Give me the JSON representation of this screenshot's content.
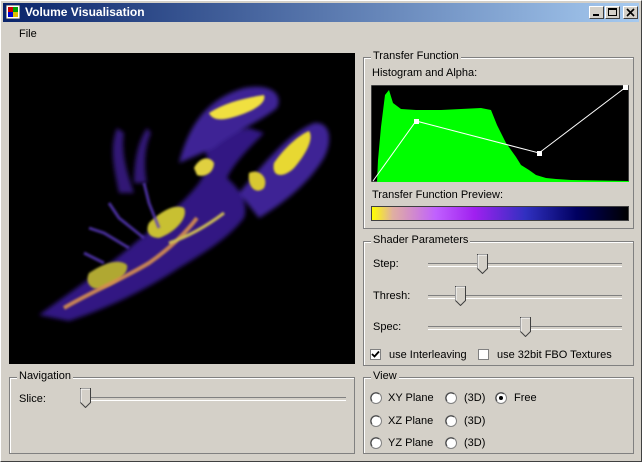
{
  "window": {
    "title": "Volume Visualisation",
    "icon": "app-icon",
    "controls": [
      "minimize-icon",
      "maximize-icon",
      "close-icon"
    ]
  },
  "menu": {
    "file": "File"
  },
  "transfer_function": {
    "group_title": "Transfer Function",
    "histogram_label": "Histogram and Alpha:",
    "preview_label": "Transfer Function Preview:",
    "histogram_color": "#00ff00",
    "gradient_colors": [
      "#ffff00",
      "#e080ff",
      "#a020f0",
      "#2020c0",
      "#000040",
      "#000000"
    ]
  },
  "shader": {
    "group_title": "Shader Parameters",
    "step_label": "Step:",
    "step_value": 0.27,
    "thresh_label": "Thresh:",
    "thresh_value": 0.15,
    "spec_label": "Spec:",
    "spec_value": 0.5,
    "interleaving_label": "use Interleaving",
    "interleaving_checked": true,
    "fbo_label": "use 32bit FBO Textures",
    "fbo_checked": false
  },
  "navigation": {
    "group_title": "Navigation",
    "slice_label": "Slice:",
    "slice_value": 0.0
  },
  "view": {
    "group_title": "View",
    "xy_label": "XY Plane",
    "xz_label": "XZ Plane",
    "yz_label": "YZ Plane",
    "d3_label": "(3D)",
    "free_label": "Free",
    "selected": "free"
  }
}
